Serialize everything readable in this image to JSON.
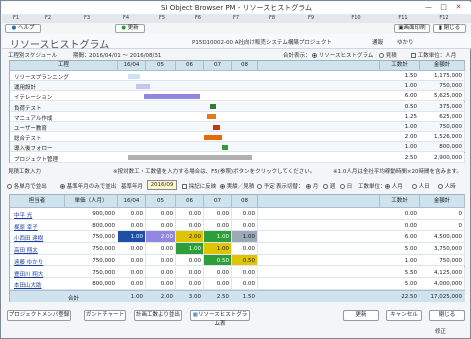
{
  "title": "SI Object Browser PM - リソースヒストグラム",
  "window_controls": [
    "—",
    "□",
    "✕"
  ],
  "fkeys": [
    "F1",
    "F2",
    "F3",
    "F4",
    "F5",
    "F6",
    "F7",
    "F8",
    "F9",
    "F10",
    "F11",
    "F12"
  ],
  "toolbar": {
    "help": "ヘルプ",
    "refresh": "更新",
    "screen_print": "画面印刷",
    "close": "閉じる"
  },
  "header": {
    "heading": "リソースヒストグラム",
    "project_line": "P15D10002-00 A社向け販売システム構築プロジェクト",
    "user_label": "通報",
    "user": "ゆかり",
    "schedule_label": "工程別スケジュール",
    "period_label": "期間：",
    "period_value": "2016/04/01 〜 2016/08/31",
    "total_display_label": "合計表示：",
    "opt_histogram": "リソースヒストグラム",
    "opt_plan": "見積",
    "opt_effort_unit": "工数単位：人月"
  },
  "top_grid": {
    "headers": [
      "工程",
      "16/04",
      "05",
      "06",
      "07",
      "08",
      "",
      "工数計",
      "金額計"
    ],
    "rows": [
      {
        "name": "リリースプランニング",
        "effort": "1.50",
        "amount": "1,175,000"
      },
      {
        "name": "運用設計",
        "effort": "1.00",
        "amount": "750,000"
      },
      {
        "name": "イテレーション",
        "effort": "6.00",
        "amount": "5,625,000"
      },
      {
        "name": "負荷テスト",
        "effort": "0.50",
        "amount": "375,000"
      },
      {
        "name": "マニュアル作成",
        "effort": "1.25",
        "amount": "625,000"
      },
      {
        "name": "ユーザー教育",
        "effort": "1.00",
        "amount": "750,000"
      },
      {
        "name": "総合テスト",
        "effort": "2.00",
        "amount": "1,526,000"
      },
      {
        "name": "導入後フォロー",
        "effort": "1.00",
        "amount": "800,000"
      },
      {
        "name": "プロジェクト管理",
        "effort": "2.50",
        "amount": "2,900,000"
      }
    ]
  },
  "mid": {
    "label": "見積工数入力",
    "note1": "※按対数工・工数値を入力する場合は、F5(参照)ボタンをクリックしてください。",
    "note2": "※1.0人月は全社平均稼動時間×20時間を含みます。",
    "opt_month": "各単月で並出",
    "opt_base_month": "基準年月のみで並出",
    "base_month_label": "基準年月",
    "base_month_value": "2016/09",
    "opt_check": "採記に反映",
    "opt_actual": "実績／見積",
    "opt_schedule": "予定",
    "display_unit": "表示切替：",
    "opt_m": "月",
    "opt_w": "週",
    "opt_d": "日",
    "effort_unit": "工数単位：",
    "opt_person_month": "人月",
    "opt_person_day": "人日",
    "opt_person_hour": "人時"
  },
  "bottom_grid": {
    "headers": [
      "担当者",
      "単価（人月）",
      "16/04",
      "05",
      "06",
      "07",
      "08",
      "",
      "工数計",
      "金額計"
    ],
    "rows": [
      {
        "name": "中平 光",
        "rate": "900,000",
        "m": [
          "0.00",
          "0.00",
          "0.00",
          "0.00",
          "0.00"
        ],
        "effort": "0.00",
        "amount": "0"
      },
      {
        "name": "梶原 幸子",
        "rate": "800,000",
        "m": [
          "0.00",
          "0.00",
          "0.00",
          "0.00",
          "0.00"
        ],
        "effort": "0.00",
        "amount": "0"
      },
      {
        "name": "小西田 達樹",
        "rate": "750,000",
        "m": [
          "1.00",
          "2.00",
          "2.00",
          "1.00",
          "1.00"
        ],
        "effort": "6.00",
        "amount": "4,500,000"
      },
      {
        "name": "高田 翔太",
        "rate": "750,000",
        "m": [
          "0.00",
          "0.00",
          "1.00",
          "1.00",
          "0.00"
        ],
        "effort": "5.00",
        "amount": "3,750,000"
      },
      {
        "name": "遠藤 ゆかり",
        "rate": "750,000",
        "m": [
          "0.00",
          "0.00",
          "0.00",
          "0.50",
          "0.50"
        ],
        "effort": "1.00",
        "amount": "750,000"
      },
      {
        "name": "豊田川 翔大",
        "rate": "750,000",
        "m": [
          "0.00",
          "0.00",
          "0.00",
          "0.00",
          "0.00"
        ],
        "effort": "5.50",
        "amount": "4,125,000"
      },
      {
        "name": "本田山大助",
        "rate": "800,000",
        "m": [
          "0.00",
          "0.00",
          "0.00",
          "0.00",
          "0.00"
        ],
        "effort": "5.00",
        "amount": "4,000,000"
      }
    ],
    "total_label": "合計",
    "total": {
      "m": [
        "1.00",
        "2.00",
        "3.00",
        "2.50",
        "1.50"
      ],
      "effort": "22.50",
      "amount": "17,025,000"
    }
  },
  "footer": {
    "member_reg": "プロジェクトメンバ登録",
    "gantt": "ガントチャート",
    "plan_effort": "計画工数より並出",
    "histogram_table": "リソースヒストグラム表",
    "refresh": "更新",
    "cancel": "キャンセル",
    "close": "閉じる",
    "status": "修正"
  },
  "colors": {
    "grid_header": "#cfe3ef",
    "bar_blue": "#1f4ea8",
    "bar_yellow": "#e0c400",
    "bar_green": "#2e9e3a",
    "bar_violet": "#9087e0"
  }
}
